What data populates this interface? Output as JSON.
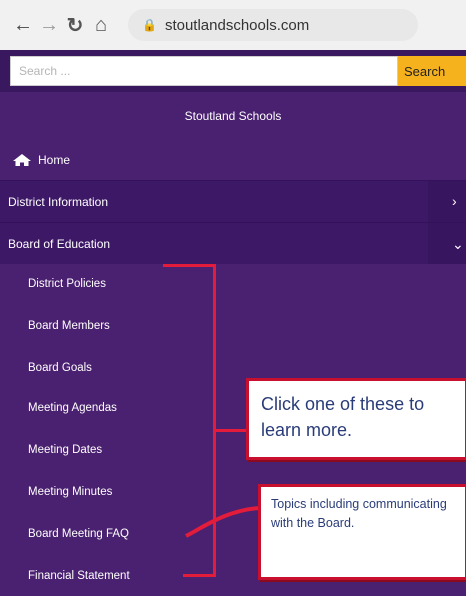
{
  "browser": {
    "url": "stoutlandschools.com",
    "back_icon": "back-arrow-icon",
    "forward_icon": "forward-arrow-icon",
    "reload_icon": "reload-icon",
    "home_icon": "home-icon"
  },
  "search": {
    "placeholder": "Search ...",
    "button_label": "Search"
  },
  "site": {
    "title": "Stoutland Schools"
  },
  "nav": {
    "home_label": "Home",
    "items": [
      {
        "label": "District Information",
        "state": "collapsed"
      },
      {
        "label": "Board of Education",
        "state": "expanded"
      }
    ],
    "board_subitems": [
      "District Policies",
      "Board Members",
      "Board Goals",
      "Meeting Agendas",
      "Meeting Dates",
      "Meeting Minutes",
      "Board Meeting FAQ",
      "Financial Statement"
    ]
  },
  "callouts": {
    "main": "Click one of these to learn more.",
    "faq": "Topics including communicating with the Board."
  },
  "colors": {
    "menu_background": "#4a2070",
    "search_button": "#f5b21d",
    "annotation_red": "#e21c3a",
    "callout_text": "#2a3c78"
  }
}
